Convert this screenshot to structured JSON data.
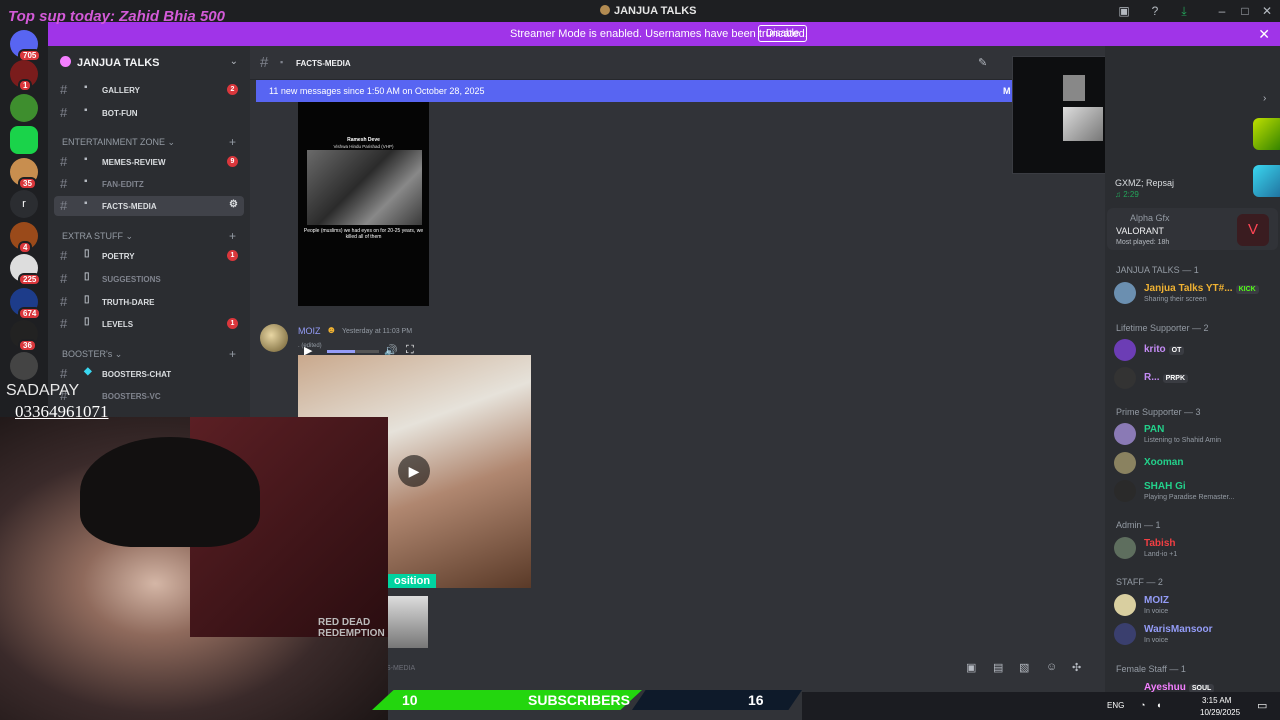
{
  "overlay": {
    "promo_text": "Top sup today: Zahid Bhia 500",
    "sadapay": "SADAPAY",
    "phone": "03364961071",
    "sub_current": "10",
    "sub_label": "SUBSCRIBERS",
    "sub_goal": "16",
    "webcam_poster_text": "RED DEAD REDEMPTION"
  },
  "window": {
    "title": "JANJUA TALKS"
  },
  "streamer_banner": {
    "text": "Streamer Mode is enabled. Usernames have been truncated.",
    "button": "Disable"
  },
  "server_rail": {
    "badges": [
      "705",
      "1",
      "35",
      "4",
      "225",
      "674",
      "36"
    ],
    "letter": "r"
  },
  "sidebar": {
    "server_name": "JANJUA TALKS",
    "channels": [
      {
        "name": "GALLERY",
        "badge": "2"
      },
      {
        "name": "BOT-FUN",
        "badge": ""
      }
    ],
    "cat_entertainment": "ENTERTAINMENT ZONE",
    "entertainment_channels": [
      {
        "name": "MEMES-REVIEW",
        "badge": "9"
      },
      {
        "name": "FAN-EDITZ",
        "badge": ""
      },
      {
        "name": "FACTS-MEDIA",
        "badge": ""
      }
    ],
    "cat_extra": "EXTRA STUFF",
    "extra_channels": [
      {
        "name": "POETRY",
        "badge": "1"
      },
      {
        "name": "SUGGESTIONS",
        "badge": ""
      },
      {
        "name": "TRUTH-DARE",
        "badge": ""
      },
      {
        "name": "LEVELS",
        "badge": "1"
      }
    ],
    "cat_booster": "BOOSTER's",
    "booster_channels": [
      {
        "name": "BOOSTERS-CHAT"
      },
      {
        "name": "BOOSTERS-VC"
      }
    ]
  },
  "chat": {
    "channel_name": "FACTS-MEDIA",
    "new_messages": "11 new messages since 1:50 AM on October 28, 2025",
    "new_messages_right": "M",
    "video1": {
      "title": "Ramesh Deve",
      "subtitle": "Vishwa Hindu Parishad (VHP)",
      "caption": "People (muslims) we had eyes on for 20-25 years, we killed all of them"
    },
    "message": {
      "author": "MOIZ",
      "time": "Yesterday at 11:03 PM",
      "edited": ". (edited)"
    },
    "video2_label": "osition",
    "input_placeholder": "S-MEDIA"
  },
  "members": {
    "activity1": {
      "name": "GXMZ; Repsaj",
      "sub": "2:29"
    },
    "activity2": {
      "name": "Alpha Gfx",
      "title": "VALORANT",
      "sub": "Most played: 18h"
    },
    "sections": [
      {
        "title": "JANJUA TALKS — 1"
      },
      {
        "title": "Lifetime Supporter — 2"
      },
      {
        "title": "Prime Supporter — 3"
      },
      {
        "title": "Admin — 1"
      },
      {
        "title": "STAFF — 2"
      },
      {
        "title": "Female Staff — 1"
      }
    ],
    "list": [
      {
        "name": "Janjua Talks YT#...",
        "sub": "Sharing their screen",
        "tag": "KICK",
        "color": "#f0b232"
      },
      {
        "name": "krito",
        "sub": "",
        "tag": "OT",
        "color": "#c48bf5"
      },
      {
        "name": "R...",
        "sub": "",
        "tag": "PRPK",
        "color": "#c48bf5"
      },
      {
        "name": "PAN",
        "sub": "Listening to Shahid Amin",
        "tag": "",
        "color": "#23d18b"
      },
      {
        "name": "Xooman",
        "sub": "",
        "tag": "",
        "color": "#23d18b"
      },
      {
        "name": "SHAH Gi",
        "sub": "Playing Paradise Remaster...",
        "tag": "",
        "color": "#23d18b"
      },
      {
        "name": "Tabish",
        "sub": "Land-io +1",
        "tag": "",
        "color": "#f23f43"
      },
      {
        "name": "MOIZ",
        "sub": "In voice",
        "tag": "",
        "color": "#949cf7"
      },
      {
        "name": "WarisMansoor",
        "sub": "In voice",
        "tag": "",
        "color": "#949cf7"
      },
      {
        "name": "Ayeshuu",
        "sub": "",
        "tag": "SOUL",
        "color": "#f47fff"
      }
    ]
  },
  "taskbar": {
    "lang": "ENG",
    "time": "3:15 AM",
    "date": "10/29/2025"
  }
}
